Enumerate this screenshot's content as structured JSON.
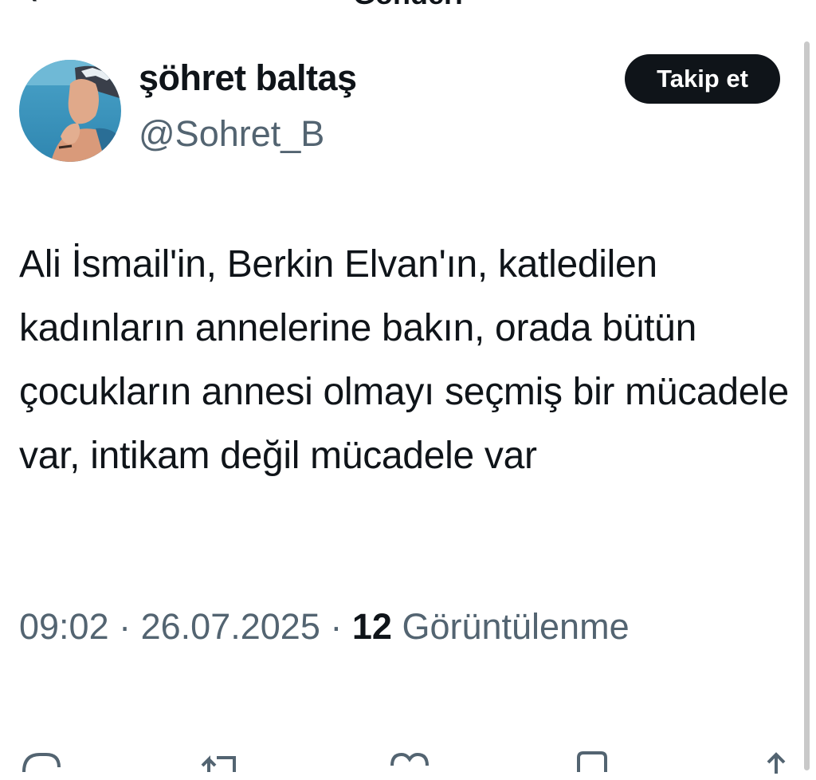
{
  "header": {
    "title": "Gönderi",
    "back_icon": "chevron-left-icon"
  },
  "author": {
    "display_name": "şöhret baltaş",
    "handle": "@Sohret_B",
    "avatar_icon": "profile-photo"
  },
  "follow_button": {
    "label": "Takip et"
  },
  "tweet": {
    "text": "Ali İsmail'in, Berkin Elvan'ın, katledilen kadınların annelerine bakın, orada bütün çocukların annesi olmayı seçmiş bir mücadele var, intikam değil mücadele var"
  },
  "meta": {
    "time": "09:02",
    "separator": " · ",
    "date": "26.07.2025",
    "views_count": "12",
    "views_label": "Görüntülenme"
  },
  "actions": [
    {
      "name": "reply",
      "icon": "reply-icon"
    },
    {
      "name": "repost",
      "icon": "repost-icon"
    },
    {
      "name": "like",
      "icon": "heart-icon"
    },
    {
      "name": "bookmark",
      "icon": "bookmark-icon"
    },
    {
      "name": "share",
      "icon": "share-icon"
    }
  ],
  "colors": {
    "text_primary": "#0f1419",
    "text_secondary": "#536471",
    "button_bg": "#0f1419",
    "button_text": "#ffffff"
  }
}
